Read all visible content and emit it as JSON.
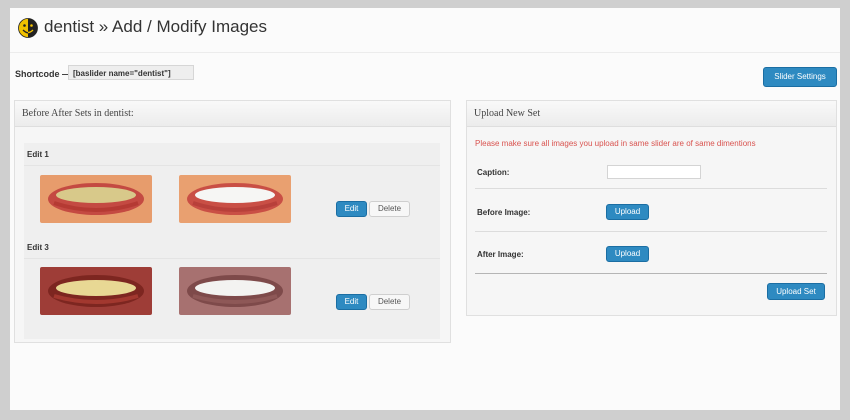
{
  "page": {
    "title": "dentist » Add / Modify Images"
  },
  "shortcode": {
    "label": "Shortcode —",
    "value": "[baslider name=\"dentist\"]"
  },
  "toolbar": {
    "slider_settings_label": "Slider Settings"
  },
  "sets_panel": {
    "heading": "Before After Sets in dentist:",
    "sets": [
      {
        "label": "Edit 1",
        "edit_label": "Edit",
        "delete_label": "Delete"
      },
      {
        "label": "Edit 3",
        "edit_label": "Edit",
        "delete_label": "Delete"
      }
    ]
  },
  "upload_panel": {
    "heading": "Upload New Set",
    "warning": "Please make sure all images you upload in same slider are of same dimentions",
    "caption_label": "Caption:",
    "caption_value": "",
    "before_label": "Before Image:",
    "after_label": "After Image:",
    "upload_label": "Upload",
    "submit_label": "Upload Set"
  },
  "colors": {
    "accent": "#2e8ac1",
    "warning": "#d9534f",
    "logo": "#f2c200"
  }
}
